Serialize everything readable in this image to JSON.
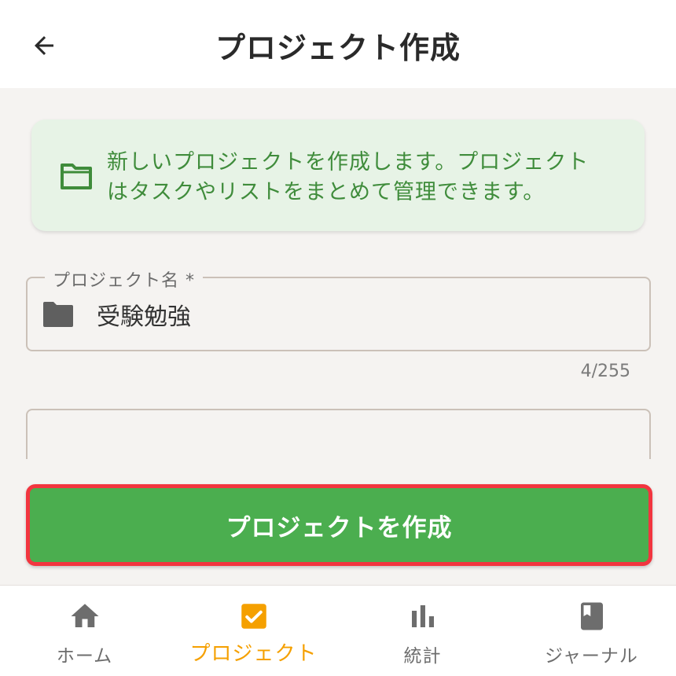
{
  "app_bar": {
    "title": "プロジェクト作成",
    "back_icon": "arrow-left-icon"
  },
  "info_card": {
    "icon": "folder-outline-icon",
    "text": "新しいプロジェクトを作成します。プロジェクトはタスクやリストをまとめて管理できます。"
  },
  "project_name_field": {
    "label": "プロジェクト名 *",
    "icon": "folder-icon",
    "value": "受験勉強",
    "counter": "4/255"
  },
  "description_field": {
    "value": ""
  },
  "create_button": {
    "label": "プロジェクトを作成"
  },
  "bottom_nav": {
    "items": [
      {
        "label": "ホーム",
        "icon": "home-icon",
        "active": false
      },
      {
        "label": "プロジェクト",
        "icon": "checkbox-icon",
        "active": true
      },
      {
        "label": "統計",
        "icon": "bar-chart-icon",
        "active": false
      },
      {
        "label": "ジャーナル",
        "icon": "book-icon",
        "active": false
      }
    ]
  },
  "colors": {
    "primary": "#4bae4f",
    "accent": "#f5a000",
    "info_bg": "#e7f3e6",
    "info_text": "#3f8c3b",
    "highlight_border": "#f2353f"
  }
}
